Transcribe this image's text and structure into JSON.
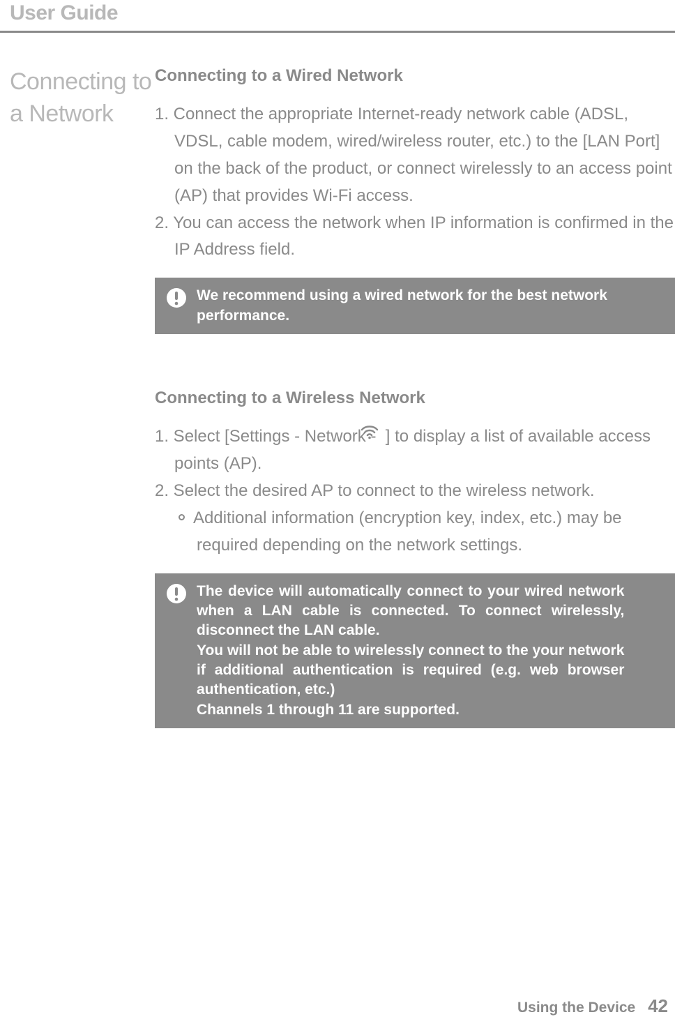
{
  "header": {
    "title": "User Guide"
  },
  "sidebar": {
    "title": "Connecting to a Network"
  },
  "section1": {
    "heading": "Connecting to a Wired Network",
    "step1": "1. Connect the appropriate Internet-ready network cable (ADSL, VDSL, cable modem, wired/wireless router, etc.) to the [LAN Port] on the back of the product, or connect wirelessly to an access point (AP) that provides Wi-Fi access.",
    "step2": "2. You can access the network when IP information is confirmed in the IP Address field.",
    "callout": "We recommend using a wired network for the best network performance."
  },
  "section2": {
    "heading": "Connecting to a Wireless Network",
    "step1_pre": "1. Select [Settings - Network - ",
    "step1_post": " ] to display a list of available access points (AP).",
    "step2": "2. Select the desired AP to connect to the wireless network.",
    "sub_bullet": "Additional information (encryption key, index, etc.) may be required depending on the network settings.",
    "callout_l1": "The device will automatically connect to your wired network",
    "callout_l2": "when a LAN cable is connected. To connect wirelessly,",
    "callout_l3": "disconnect the LAN cable.",
    "callout_l4": "You will not be able to wirelessly connect to the your network",
    "callout_l5": "if additional authentication is required (e.g. web browser",
    "callout_l6": "authentication, etc.)",
    "callout_l7": "Channels 1 through 11 are supported."
  },
  "footer": {
    "section": "Using the Device",
    "page": "42"
  }
}
